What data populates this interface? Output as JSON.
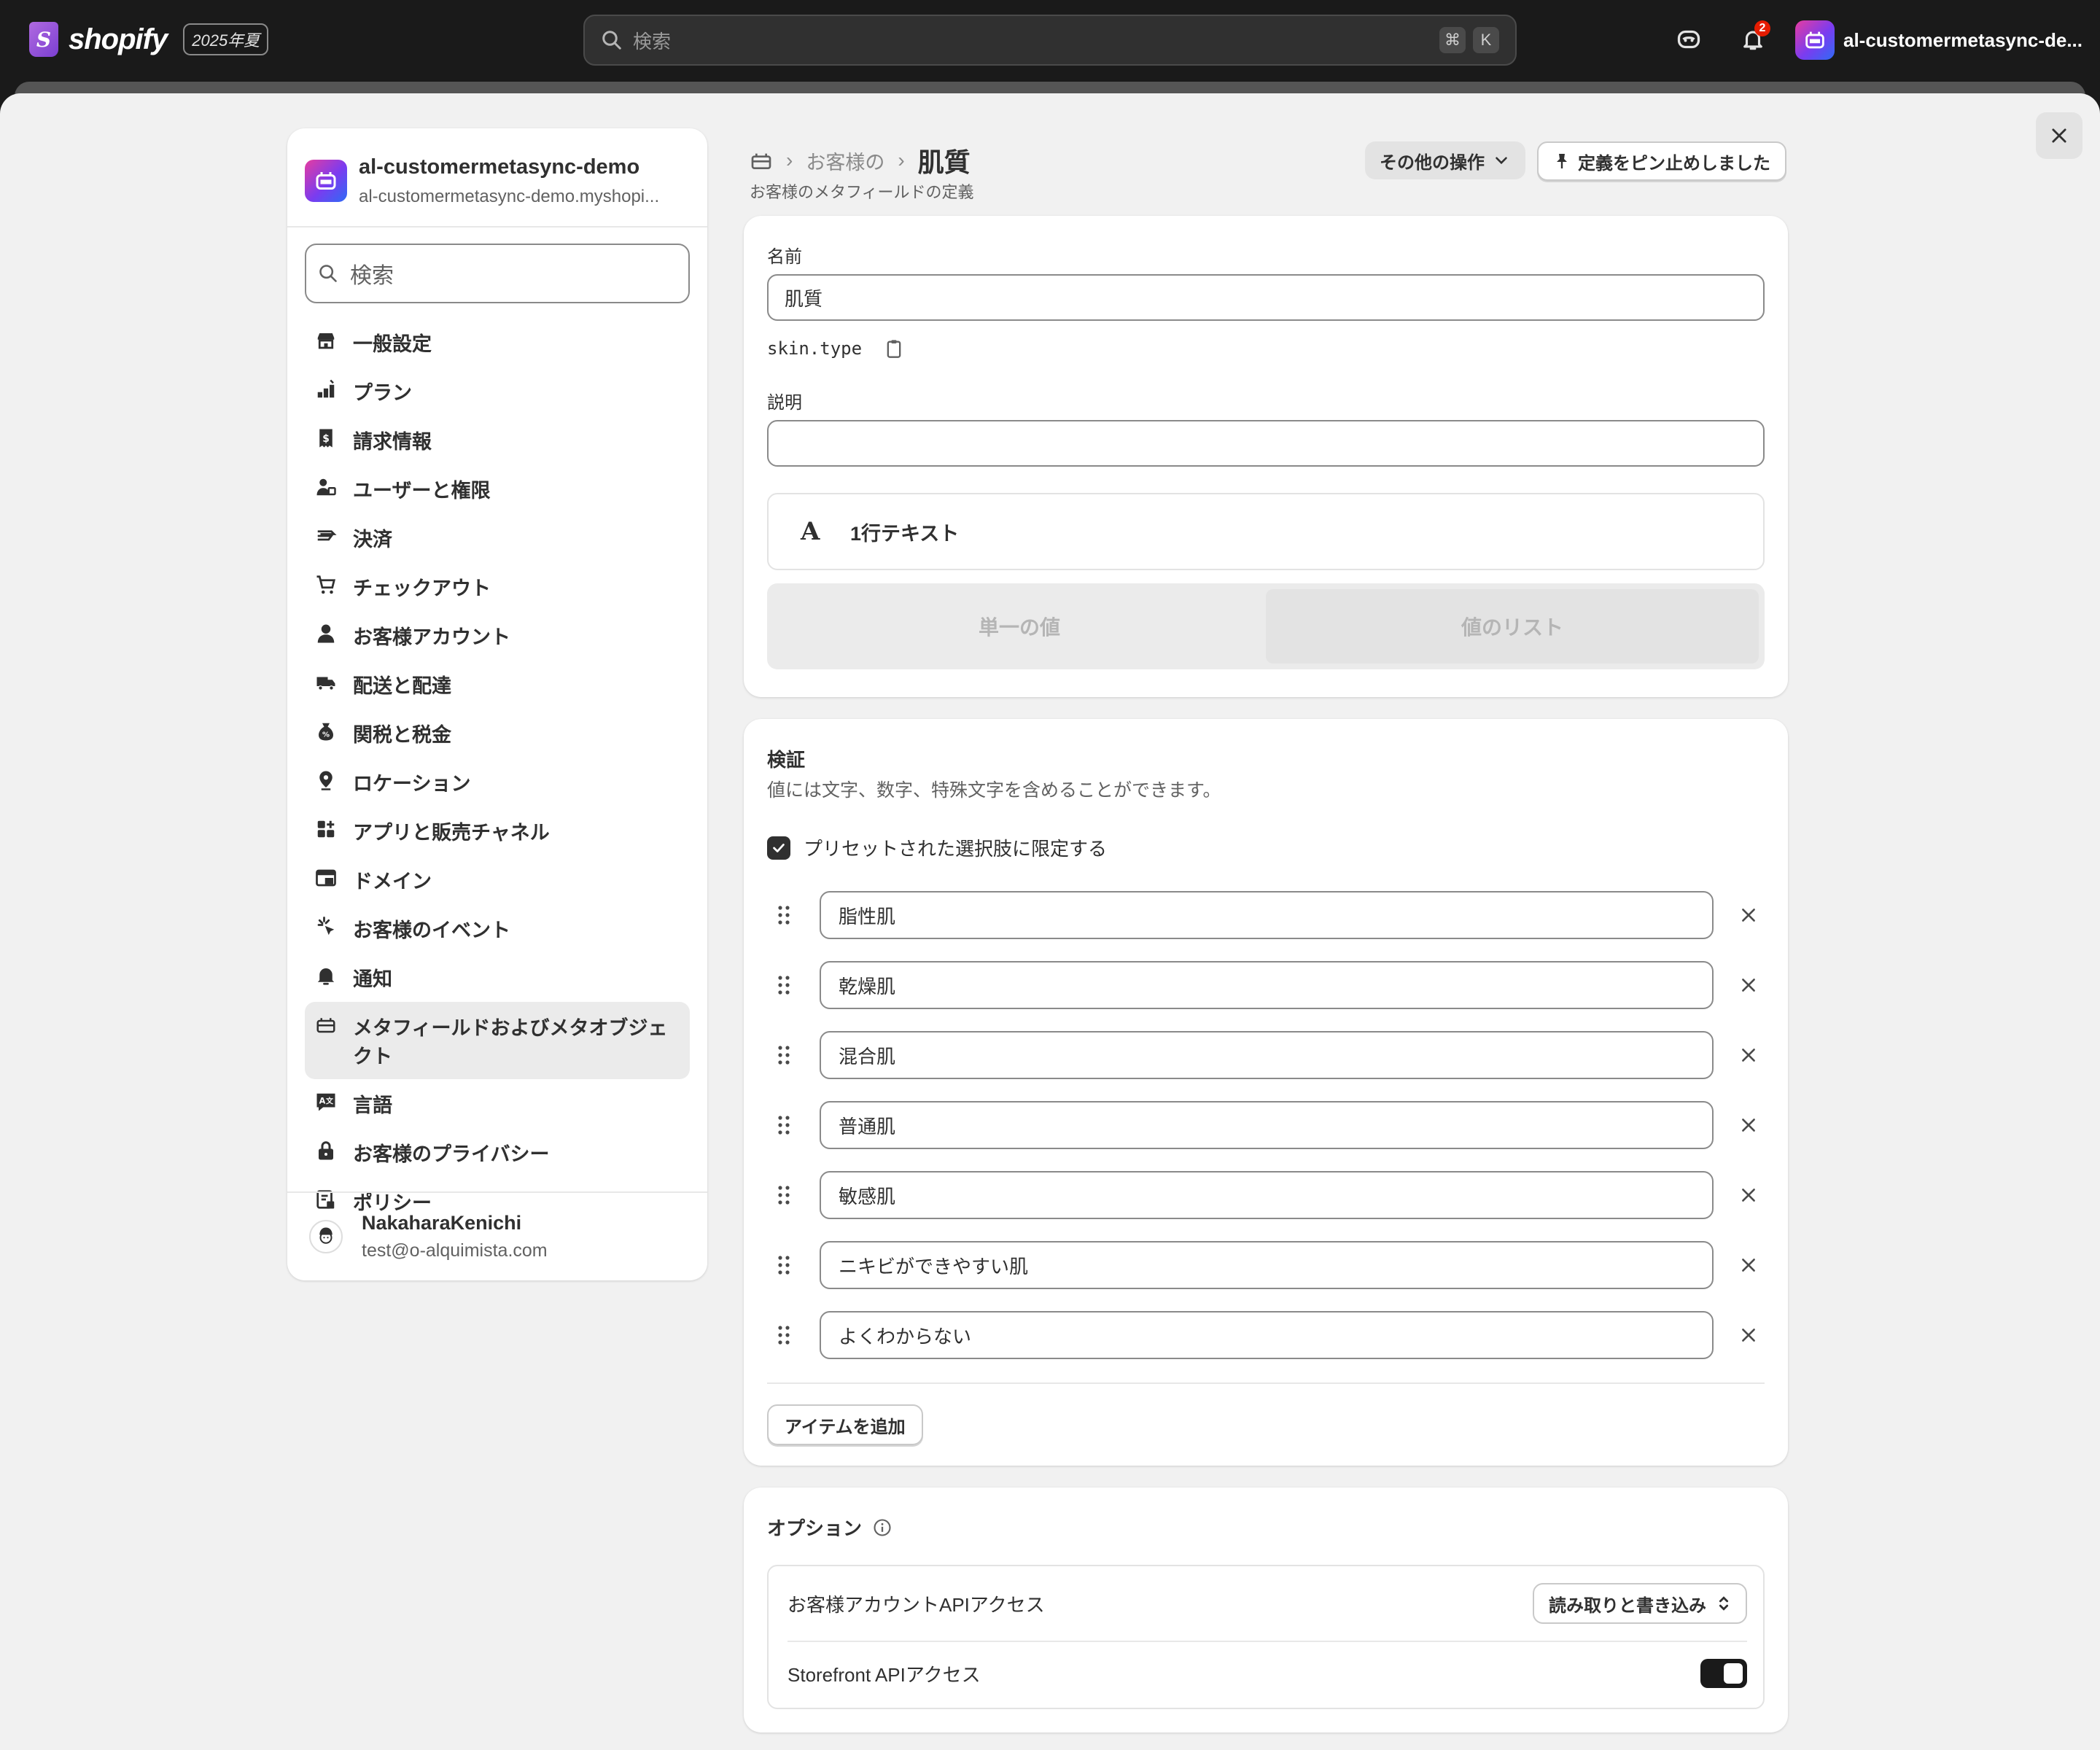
{
  "topbar": {
    "brand": "shopify",
    "edition": "2025年夏",
    "search_placeholder": "検索",
    "kbd_cmd": "⌘",
    "kbd_k": "K",
    "notification_count": "2",
    "store_name": "al-customermetasync-de..."
  },
  "sidebar": {
    "store_title": "al-customermetasync-demo",
    "store_domain": "al-customermetasync-demo.myshopi...",
    "search_placeholder": "検索",
    "items": [
      {
        "label": "一般設定",
        "icon": "store-icon"
      },
      {
        "label": "プラン",
        "icon": "plan-icon"
      },
      {
        "label": "請求情報",
        "icon": "receipt-icon"
      },
      {
        "label": "ユーザーと権限",
        "icon": "users-icon"
      },
      {
        "label": "決済",
        "icon": "payment-icon"
      },
      {
        "label": "チェックアウト",
        "icon": "cart-icon"
      },
      {
        "label": "お客様アカウント",
        "icon": "person-icon"
      },
      {
        "label": "配送と配達",
        "icon": "truck-icon"
      },
      {
        "label": "関税と税金",
        "icon": "tax-icon"
      },
      {
        "label": "ロケーション",
        "icon": "location-icon"
      },
      {
        "label": "アプリと販売チャネル",
        "icon": "apps-icon"
      },
      {
        "label": "ドメイン",
        "icon": "domain-icon"
      },
      {
        "label": "お客様のイベント",
        "icon": "events-icon"
      },
      {
        "label": "通知",
        "icon": "bell-icon"
      },
      {
        "label": "メタフィールドおよびメタオブジェクト",
        "icon": "metafield-icon"
      },
      {
        "label": "言語",
        "icon": "language-icon"
      },
      {
        "label": "お客様のプライバシー",
        "icon": "lock-icon"
      },
      {
        "label": "ポリシー",
        "icon": "policy-icon"
      }
    ],
    "user_name": "NakaharaKenichi",
    "user_email": "test@o-alquimista.com"
  },
  "header": {
    "breadcrumb_parent": "お客様の",
    "title": "肌質",
    "subtitle": "お客様のメタフィールドの定義",
    "more_actions": "その他の操作",
    "pinned": "定義をピン止めしました"
  },
  "definition": {
    "name_label": "名前",
    "name_value": "肌質",
    "key": "skin.type",
    "description_label": "説明",
    "description_value": "",
    "type_label": "1行テキスト",
    "single_value": "単一の値",
    "list_value": "値のリスト"
  },
  "validation": {
    "title": "検証",
    "description": "値には文字、数字、特殊文字を含めることができます。",
    "limit_label": "プリセットされた選択肢に限定する",
    "options": [
      "脂性肌",
      "乾燥肌",
      "混合肌",
      "普通肌",
      "敏感肌",
      "ニキビができやすい肌",
      "よくわからない"
    ],
    "add_item": "アイテムを追加"
  },
  "options": {
    "title": "オプション",
    "customer_api_label": "お客様アカウントAPIアクセス",
    "customer_api_value": "読み取りと書き込み",
    "storefront_label": "Storefront APIアクセス",
    "storefront_enabled": true
  }
}
